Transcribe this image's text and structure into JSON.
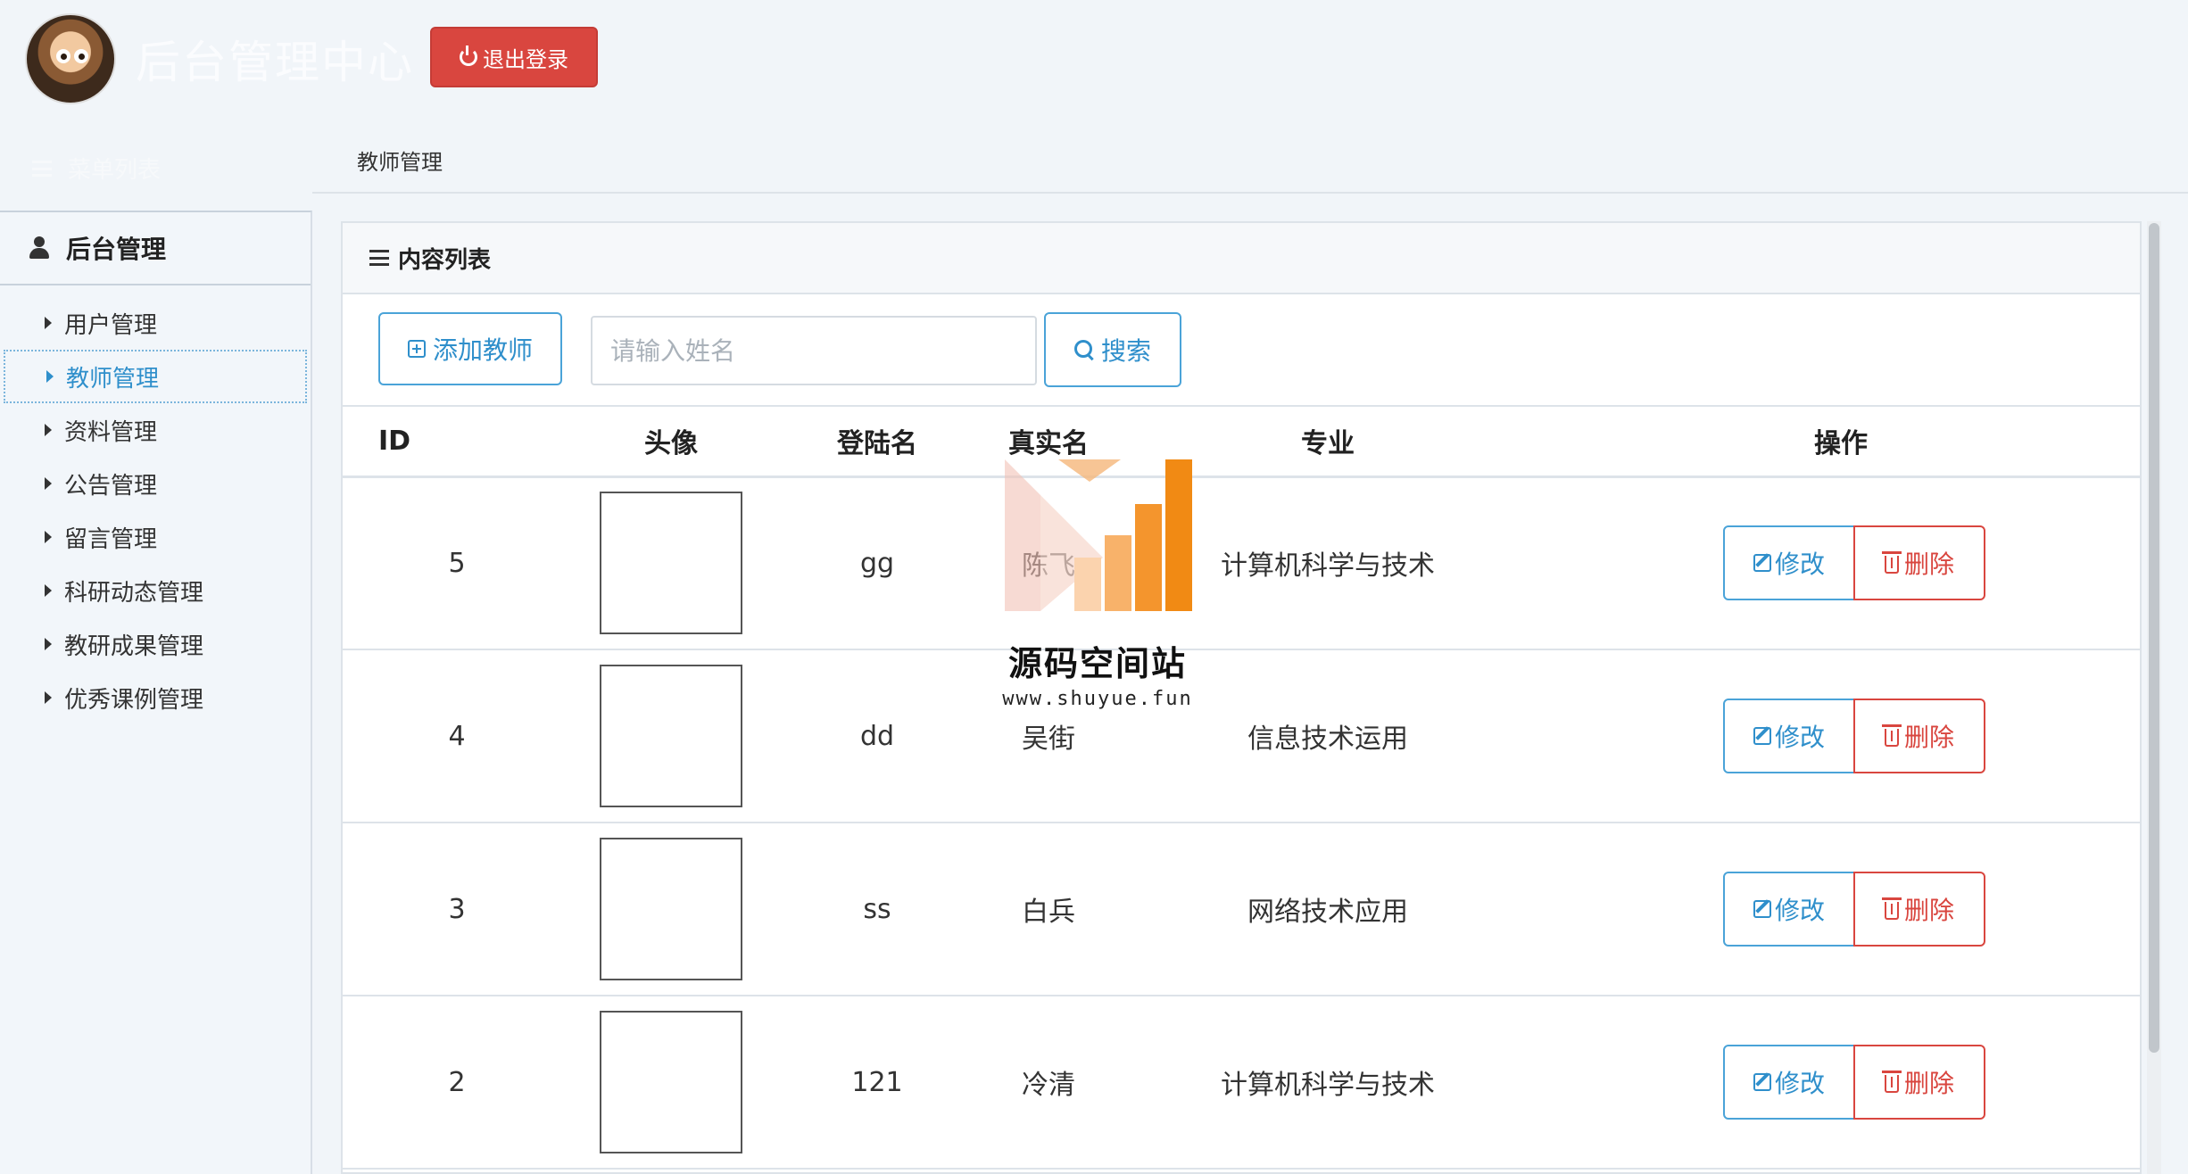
{
  "header": {
    "title": "后台管理中心",
    "logout_label": "退出登录"
  },
  "menu_list_label": "菜单列表",
  "breadcrumb": "教师管理",
  "sidebar": {
    "title": "后台管理",
    "items": [
      {
        "label": "用户管理"
      },
      {
        "label": "教师管理"
      },
      {
        "label": "资料管理"
      },
      {
        "label": "公告管理"
      },
      {
        "label": "留言管理"
      },
      {
        "label": "科研动态管理"
      },
      {
        "label": "教研成果管理"
      },
      {
        "label": "优秀课例管理"
      }
    ],
    "active_index": 1
  },
  "panel": {
    "title": "内容列表",
    "add_label": "添加教师",
    "search_placeholder": "请输入姓名",
    "search_label": "搜索"
  },
  "table": {
    "columns": [
      "ID",
      "头像",
      "登陆名",
      "真实名",
      "专业",
      "操作"
    ],
    "rows": [
      {
        "id": "5",
        "login": "gg",
        "real": "陈飞",
        "major": "计算机科学与技术"
      },
      {
        "id": "4",
        "login": "dd",
        "real": "吴街",
        "major": "信息技术运用"
      },
      {
        "id": "3",
        "login": "ss",
        "real": "白兵",
        "major": "网络技术应用"
      },
      {
        "id": "2",
        "login": "121",
        "real": "冷清",
        "major": "计算机科学与技术"
      }
    ],
    "edit_label": "修改",
    "delete_label": "删除"
  },
  "watermark": {
    "title": "源码空间站",
    "url": "www.shuyue.fun"
  },
  "colors": {
    "primary": "#2f8fcb",
    "danger": "#d9463f",
    "background": "#f1f5f9"
  }
}
